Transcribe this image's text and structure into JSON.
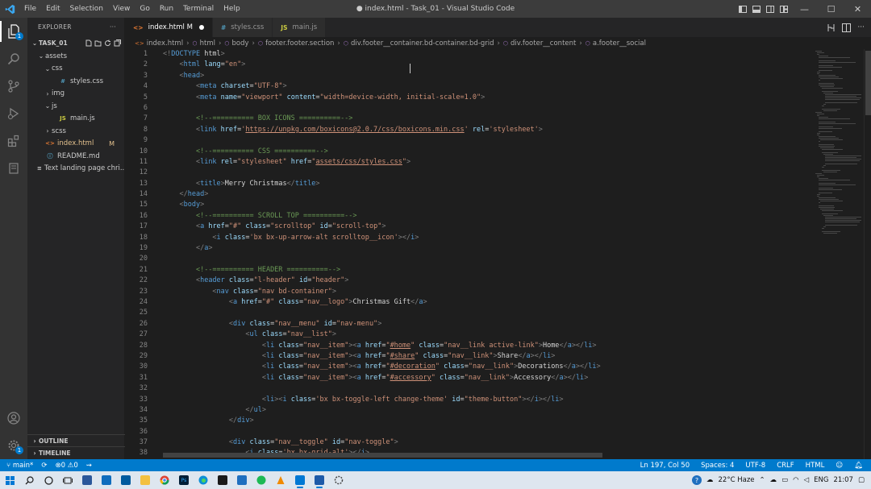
{
  "window": {
    "title": "● index.html - Task_01 - Visual Studio Code",
    "menu": [
      "File",
      "Edit",
      "Selection",
      "View",
      "Go",
      "Run",
      "Terminal",
      "Help"
    ],
    "controls": {
      "minimize": "—",
      "maximize": "☐",
      "close": "✕"
    }
  },
  "activity_bar": {
    "items": [
      "files-icon",
      "search-icon",
      "source-control-icon",
      "run-debug-icon",
      "extensions-icon",
      "remote-explorer-icon"
    ],
    "bottom": [
      "account-icon",
      "settings-gear-icon"
    ],
    "scm_badge": "1",
    "settings_badge": "1"
  },
  "explorer": {
    "header": "EXPLORER",
    "more": "···",
    "workspace": "TASK_01",
    "tree": [
      {
        "label": "assets",
        "chev": "⌄",
        "depth": 1,
        "icon": ""
      },
      {
        "label": "css",
        "chev": "⌄",
        "depth": 2,
        "icon": ""
      },
      {
        "label": "styles.css",
        "chev": "",
        "depth": 3,
        "icon": "#"
      },
      {
        "label": "img",
        "chev": "›",
        "depth": 2,
        "icon": ""
      },
      {
        "label": "js",
        "chev": "⌄",
        "depth": 2,
        "icon": ""
      },
      {
        "label": "main.js",
        "chev": "",
        "depth": 3,
        "icon": "JS"
      },
      {
        "label": "scss",
        "chev": "›",
        "depth": 2,
        "icon": ""
      },
      {
        "label": "index.html",
        "chev": "",
        "depth": 1,
        "icon": "<>",
        "modified": "M"
      },
      {
        "label": "README.md",
        "chev": "",
        "depth": 1,
        "icon": "ⓘ"
      },
      {
        "label": "Text landing page chri...",
        "chev": "",
        "depth": 1,
        "icon": "≡"
      }
    ],
    "outline": "OUTLINE",
    "timeline": "TIMELINE"
  },
  "tabs": [
    {
      "label": "index.html M",
      "icon": "<>",
      "active": true
    },
    {
      "label": "styles.css",
      "icon": "#",
      "active": false
    },
    {
      "label": "main.js",
      "icon": "JS",
      "active": false
    }
  ],
  "breadcrumb": [
    "index.html",
    "html",
    "body",
    "footer.footer.section",
    "div.footer__container.bd-container.bd-grid",
    "div.footer__content",
    "a.footer__social"
  ],
  "editor": {
    "start_line": 1,
    "lines": [
      [
        [
          "p",
          "<!"
        ],
        [
          "k",
          "DOCTYPE"
        ],
        [
          "t",
          " html"
        ],
        [
          "p",
          ">"
        ]
      ],
      [
        [
          "t",
          "    "
        ],
        [
          "p",
          "<"
        ],
        [
          "k",
          "html"
        ],
        [
          "a",
          " lang"
        ],
        [
          "t",
          "="
        ],
        [
          "s",
          "\"en\""
        ],
        [
          "p",
          ">"
        ]
      ],
      [
        [
          "t",
          "    "
        ],
        [
          "p",
          "<"
        ],
        [
          "k",
          "head"
        ],
        [
          "p",
          ">"
        ]
      ],
      [
        [
          "t",
          "        "
        ],
        [
          "p",
          "<"
        ],
        [
          "k",
          "meta"
        ],
        [
          "a",
          " charset"
        ],
        [
          "t",
          "="
        ],
        [
          "s",
          "\"UTF-8\""
        ],
        [
          "p",
          ">"
        ]
      ],
      [
        [
          "t",
          "        "
        ],
        [
          "p",
          "<"
        ],
        [
          "k",
          "meta"
        ],
        [
          "a",
          " name"
        ],
        [
          "t",
          "="
        ],
        [
          "s",
          "\"viewport\""
        ],
        [
          "a",
          " content"
        ],
        [
          "t",
          "="
        ],
        [
          "s",
          "\"width=device-width, initial-scale=1.0\""
        ],
        [
          "p",
          ">"
        ]
      ],
      [],
      [
        [
          "t",
          "        "
        ],
        [
          "c",
          "<!--========== BOX ICONS ==========-->"
        ]
      ],
      [
        [
          "t",
          "        "
        ],
        [
          "p",
          "<"
        ],
        [
          "k",
          "link"
        ],
        [
          "a",
          " href"
        ],
        [
          "t",
          "="
        ],
        [
          "s",
          "'"
        ],
        [
          "u",
          "https://unpkg.com/boxicons@2.0.7/css/boxicons.min.css"
        ],
        [
          "s",
          "'"
        ],
        [
          "a",
          " rel"
        ],
        [
          "t",
          "="
        ],
        [
          "s",
          "'stylesheet'"
        ],
        [
          "p",
          ">"
        ]
      ],
      [],
      [
        [
          "t",
          "        "
        ],
        [
          "c",
          "<!--========== CSS ==========-->"
        ]
      ],
      [
        [
          "t",
          "        "
        ],
        [
          "p",
          "<"
        ],
        [
          "k",
          "link"
        ],
        [
          "a",
          " rel"
        ],
        [
          "t",
          "="
        ],
        [
          "s",
          "\"stylesheet\""
        ],
        [
          "a",
          " href"
        ],
        [
          "t",
          "="
        ],
        [
          "s",
          "\""
        ],
        [
          "u",
          "assets/css/styles.css"
        ],
        [
          "s",
          "\""
        ],
        [
          "p",
          ">"
        ]
      ],
      [],
      [
        [
          "t",
          "        "
        ],
        [
          "p",
          "<"
        ],
        [
          "k",
          "title"
        ],
        [
          "p",
          ">"
        ],
        [
          "t",
          "Merry Christmas"
        ],
        [
          "p",
          "</"
        ],
        [
          "k",
          "title"
        ],
        [
          "p",
          ">"
        ]
      ],
      [
        [
          "t",
          "    "
        ],
        [
          "p",
          "</"
        ],
        [
          "k",
          "head"
        ],
        [
          "p",
          ">"
        ]
      ],
      [
        [
          "t",
          "    "
        ],
        [
          "p",
          "<"
        ],
        [
          "k",
          "body"
        ],
        [
          "p",
          ">"
        ]
      ],
      [
        [
          "t",
          "        "
        ],
        [
          "c",
          "<!--========== SCROLL TOP ==========-->"
        ]
      ],
      [
        [
          "t",
          "        "
        ],
        [
          "p",
          "<"
        ],
        [
          "k",
          "a"
        ],
        [
          "a",
          " href"
        ],
        [
          "t",
          "="
        ],
        [
          "s",
          "\"#\""
        ],
        [
          "a",
          " class"
        ],
        [
          "t",
          "="
        ],
        [
          "s",
          "\"scrolltop\""
        ],
        [
          "a",
          " id"
        ],
        [
          "t",
          "="
        ],
        [
          "s",
          "\"scroll-top\""
        ],
        [
          "p",
          ">"
        ]
      ],
      [
        [
          "t",
          "            "
        ],
        [
          "p",
          "<"
        ],
        [
          "k",
          "i"
        ],
        [
          "a",
          " class"
        ],
        [
          "t",
          "="
        ],
        [
          "s",
          "'bx bx-up-arrow-alt scrolltop__icon'"
        ],
        [
          "p",
          "></"
        ],
        [
          "k",
          "i"
        ],
        [
          "p",
          ">"
        ]
      ],
      [
        [
          "t",
          "        "
        ],
        [
          "p",
          "</"
        ],
        [
          "k",
          "a"
        ],
        [
          "p",
          ">"
        ]
      ],
      [],
      [
        [
          "t",
          "        "
        ],
        [
          "c",
          "<!--========== HEADER ==========-->"
        ]
      ],
      [
        [
          "t",
          "        "
        ],
        [
          "p",
          "<"
        ],
        [
          "k",
          "header"
        ],
        [
          "a",
          " class"
        ],
        [
          "t",
          "="
        ],
        [
          "s",
          "\"l-header\""
        ],
        [
          "a",
          " id"
        ],
        [
          "t",
          "="
        ],
        [
          "s",
          "\"header\""
        ],
        [
          "p",
          ">"
        ]
      ],
      [
        [
          "t",
          "            "
        ],
        [
          "p",
          "<"
        ],
        [
          "k",
          "nav"
        ],
        [
          "a",
          " class"
        ],
        [
          "t",
          "="
        ],
        [
          "s",
          "\"nav bd-container\""
        ],
        [
          "p",
          ">"
        ]
      ],
      [
        [
          "t",
          "                "
        ],
        [
          "p",
          "<"
        ],
        [
          "k",
          "a"
        ],
        [
          "a",
          " href"
        ],
        [
          "t",
          "="
        ],
        [
          "s",
          "\"#\""
        ],
        [
          "a",
          " class"
        ],
        [
          "t",
          "="
        ],
        [
          "s",
          "\"nav__logo\""
        ],
        [
          "p",
          ">"
        ],
        [
          "t",
          "Christmas Gift"
        ],
        [
          "p",
          "</"
        ],
        [
          "k",
          "a"
        ],
        [
          "p",
          ">"
        ]
      ],
      [],
      [
        [
          "t",
          "                "
        ],
        [
          "p",
          "<"
        ],
        [
          "k",
          "div"
        ],
        [
          "a",
          " class"
        ],
        [
          "t",
          "="
        ],
        [
          "s",
          "\"nav__menu\""
        ],
        [
          "a",
          " id"
        ],
        [
          "t",
          "="
        ],
        [
          "s",
          "\"nav-menu\""
        ],
        [
          "p",
          ">"
        ]
      ],
      [
        [
          "t",
          "                    "
        ],
        [
          "p",
          "<"
        ],
        [
          "k",
          "ul"
        ],
        [
          "a",
          " class"
        ],
        [
          "t",
          "="
        ],
        [
          "s",
          "\"nav__list\""
        ],
        [
          "p",
          ">"
        ]
      ],
      [
        [
          "t",
          "                        "
        ],
        [
          "p",
          "<"
        ],
        [
          "k",
          "li"
        ],
        [
          "a",
          " class"
        ],
        [
          "t",
          "="
        ],
        [
          "s",
          "\"nav__item\""
        ],
        [
          "p",
          "><"
        ],
        [
          "k",
          "a"
        ],
        [
          "a",
          " href"
        ],
        [
          "t",
          "="
        ],
        [
          "s",
          "\""
        ],
        [
          "u",
          "#home"
        ],
        [
          "s",
          "\""
        ],
        [
          "a",
          " class"
        ],
        [
          "t",
          "="
        ],
        [
          "s",
          "\"nav__link active-link\""
        ],
        [
          "p",
          ">"
        ],
        [
          "t",
          "Home"
        ],
        [
          "p",
          "</"
        ],
        [
          "k",
          "a"
        ],
        [
          "p",
          "></"
        ],
        [
          "k",
          "li"
        ],
        [
          "p",
          ">"
        ]
      ],
      [
        [
          "t",
          "                        "
        ],
        [
          "p",
          "<"
        ],
        [
          "k",
          "li"
        ],
        [
          "a",
          " class"
        ],
        [
          "t",
          "="
        ],
        [
          "s",
          "\"nav__item\""
        ],
        [
          "p",
          "><"
        ],
        [
          "k",
          "a"
        ],
        [
          "a",
          " href"
        ],
        [
          "t",
          "="
        ],
        [
          "s",
          "\""
        ],
        [
          "u",
          "#share"
        ],
        [
          "s",
          "\""
        ],
        [
          "a",
          " class"
        ],
        [
          "t",
          "="
        ],
        [
          "s",
          "\"nav__link\""
        ],
        [
          "p",
          ">"
        ],
        [
          "t",
          "Share"
        ],
        [
          "p",
          "</"
        ],
        [
          "k",
          "a"
        ],
        [
          "p",
          "></"
        ],
        [
          "k",
          "li"
        ],
        [
          "p",
          ">"
        ]
      ],
      [
        [
          "t",
          "                        "
        ],
        [
          "p",
          "<"
        ],
        [
          "k",
          "li"
        ],
        [
          "a",
          " class"
        ],
        [
          "t",
          "="
        ],
        [
          "s",
          "\"nav__item\""
        ],
        [
          "p",
          "><"
        ],
        [
          "k",
          "a"
        ],
        [
          "a",
          " href"
        ],
        [
          "t",
          "="
        ],
        [
          "s",
          "\""
        ],
        [
          "u",
          "#decoration"
        ],
        [
          "s",
          "\""
        ],
        [
          "a",
          " class"
        ],
        [
          "t",
          "="
        ],
        [
          "s",
          "\"nav__link\""
        ],
        [
          "p",
          ">"
        ],
        [
          "t",
          "Decorations"
        ],
        [
          "p",
          "</"
        ],
        [
          "k",
          "a"
        ],
        [
          "p",
          "></"
        ],
        [
          "k",
          "li"
        ],
        [
          "p",
          ">"
        ]
      ],
      [
        [
          "t",
          "                        "
        ],
        [
          "p",
          "<"
        ],
        [
          "k",
          "li"
        ],
        [
          "a",
          " class"
        ],
        [
          "t",
          "="
        ],
        [
          "s",
          "\"nav__item\""
        ],
        [
          "p",
          "><"
        ],
        [
          "k",
          "a"
        ],
        [
          "a",
          " href"
        ],
        [
          "t",
          "="
        ],
        [
          "s",
          "\""
        ],
        [
          "u",
          "#accessory"
        ],
        [
          "s",
          "\""
        ],
        [
          "a",
          " class"
        ],
        [
          "t",
          "="
        ],
        [
          "s",
          "\"nav__link\""
        ],
        [
          "p",
          ">"
        ],
        [
          "t",
          "Accessory"
        ],
        [
          "p",
          "</"
        ],
        [
          "k",
          "a"
        ],
        [
          "p",
          "></"
        ],
        [
          "k",
          "li"
        ],
        [
          "p",
          ">"
        ]
      ],
      [],
      [
        [
          "t",
          "                        "
        ],
        [
          "p",
          "<"
        ],
        [
          "k",
          "li"
        ],
        [
          "p",
          "><"
        ],
        [
          "k",
          "i"
        ],
        [
          "a",
          " class"
        ],
        [
          "t",
          "="
        ],
        [
          "s",
          "'bx bx-toggle-left change-theme'"
        ],
        [
          "a",
          " id"
        ],
        [
          "t",
          "="
        ],
        [
          "s",
          "\"theme-button\""
        ],
        [
          "p",
          "></"
        ],
        [
          "k",
          "i"
        ],
        [
          "p",
          "></"
        ],
        [
          "k",
          "li"
        ],
        [
          "p",
          ">"
        ]
      ],
      [
        [
          "t",
          "                    "
        ],
        [
          "p",
          "</"
        ],
        [
          "k",
          "ul"
        ],
        [
          "p",
          ">"
        ]
      ],
      [
        [
          "t",
          "                "
        ],
        [
          "p",
          "</"
        ],
        [
          "k",
          "div"
        ],
        [
          "p",
          ">"
        ]
      ],
      [],
      [
        [
          "t",
          "                "
        ],
        [
          "p",
          "<"
        ],
        [
          "k",
          "div"
        ],
        [
          "a",
          " class"
        ],
        [
          "t",
          "="
        ],
        [
          "s",
          "\"nav__toggle\""
        ],
        [
          "a",
          " id"
        ],
        [
          "t",
          "="
        ],
        [
          "s",
          "\"nav-toggle\""
        ],
        [
          "p",
          ">"
        ]
      ],
      [
        [
          "t",
          "                    "
        ],
        [
          "p",
          "<"
        ],
        [
          "k",
          "i"
        ],
        [
          "a",
          " class"
        ],
        [
          "t",
          "="
        ],
        [
          "s",
          "'bx bx-grid-alt'"
        ],
        [
          "p",
          "></"
        ],
        [
          "k",
          "i"
        ],
        [
          "p",
          ">"
        ]
      ]
    ]
  },
  "status_bar": {
    "branch": "main*",
    "sync": "⟳",
    "errors": "0",
    "warnings": "0",
    "position": "Ln 197, Col 50",
    "spaces": "Spaces: 4",
    "encoding": "UTF-8",
    "eol": "CRLF",
    "language": "HTML"
  },
  "taskbar": {
    "weather": "22°C  Haze",
    "lang": "ENG",
    "time": "21:07"
  },
  "colors": {
    "accent": "#007acc",
    "keyword": "#569cd6",
    "attribute": "#9cdcfe",
    "string": "#ce9178",
    "comment": "#6a9955"
  }
}
